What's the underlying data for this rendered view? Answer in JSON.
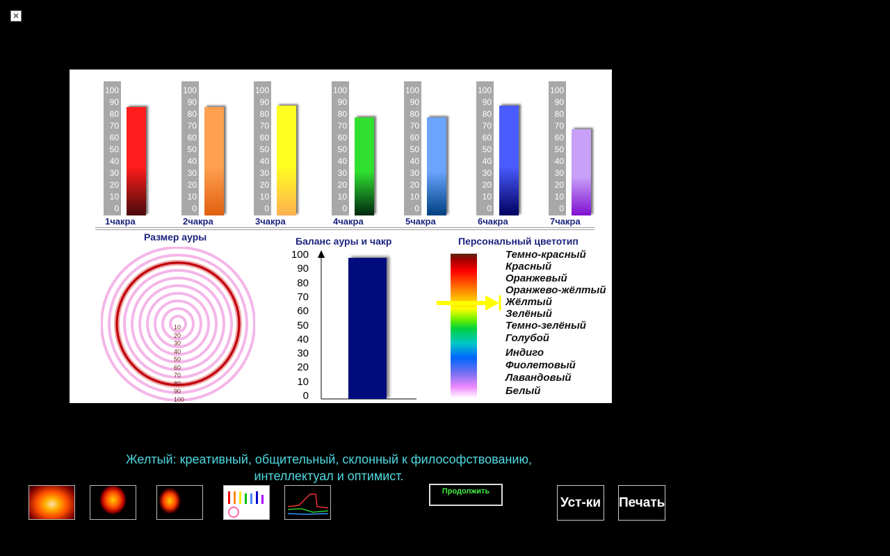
{
  "window": {
    "close_glyph": "✕"
  },
  "chakras": {
    "scale_ticks": [
      "100",
      "90",
      "80",
      "70",
      "60",
      "50",
      "40",
      "30",
      "20",
      "10",
      "0"
    ],
    "items": [
      {
        "label": "1чакра",
        "value": 89,
        "color_top": "#ff1c1c",
        "color_bottom": "#4a0a0a"
      },
      {
        "label": "2чакра",
        "value": 89,
        "color_top": "#ffa050",
        "color_bottom": "#e06010"
      },
      {
        "label": "3чакра",
        "value": 90,
        "color_top": "#ffff20",
        "color_bottom": "#ffb050"
      },
      {
        "label": "4чакра",
        "value": 80,
        "color_top": "#30e030",
        "color_bottom": "#002810"
      },
      {
        "label": "5чакра",
        "value": 80,
        "color_top": "#6aa4ff",
        "color_bottom": "#004080"
      },
      {
        "label": "6чакра",
        "value": 90,
        "color_top": "#4a5cff",
        "color_bottom": "#000060"
      },
      {
        "label": "7чакра",
        "value": 70,
        "color_top": "#c8a0f8",
        "color_bottom": "#8010d0"
      }
    ]
  },
  "aura": {
    "title": "Размер ауры",
    "ticks": [
      "10",
      "20",
      "30",
      "40",
      "50",
      "60",
      "70",
      "80",
      "90",
      "100"
    ],
    "size_value": 80
  },
  "balance": {
    "title": "Баланс ауры и чакр",
    "y_ticks": [
      "100",
      "90",
      "80",
      "70",
      "60",
      "50",
      "40",
      "30",
      "20",
      "10",
      "0"
    ],
    "value": 100
  },
  "color_type": {
    "title": "Персональный цветотип",
    "items": [
      "Темно-красный",
      "Красный",
      "Оранжевый",
      "Оранжево-жёлтый",
      "Жёлтый",
      "Зелёный",
      "Темно-зелёный",
      "Голубой",
      "Индиго",
      "Фиолетовый",
      "Лавандовый",
      "Белый"
    ],
    "selected": "Жёлтый",
    "marker_color": "#ffff00"
  },
  "description": {
    "line1": "Желтый: креативный, общительный, склонный к философствованию,",
    "line2": "интеллектуал и оптимист."
  },
  "buttons": {
    "continue": "Продолжить",
    "settings": "Уст-ки",
    "print": "Печать"
  },
  "thumbnails": [
    "thumbnail-aura-photo",
    "thumbnail-aura-silhouette",
    "thumbnail-aura-report",
    "thumbnail-chakra-chart",
    "thumbnail-line-graph"
  ]
}
